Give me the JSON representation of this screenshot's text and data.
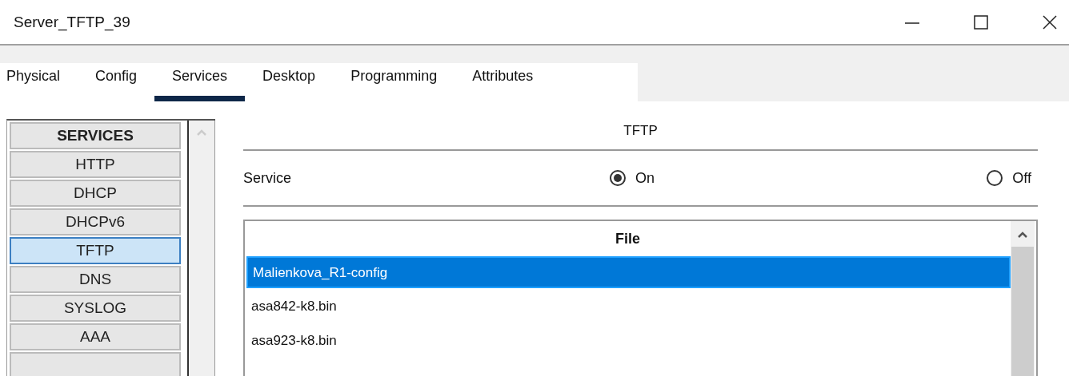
{
  "window": {
    "title": "Server_TFTP_39"
  },
  "tabs": [
    {
      "label": "Physical",
      "selected": false
    },
    {
      "label": "Config",
      "selected": false
    },
    {
      "label": "Services",
      "selected": true
    },
    {
      "label": "Desktop",
      "selected": false
    },
    {
      "label": "Programming",
      "selected": false
    },
    {
      "label": "Attributes",
      "selected": false
    }
  ],
  "sidebar": {
    "heading": "SERVICES",
    "items": [
      {
        "label": "HTTP",
        "selected": false
      },
      {
        "label": "DHCP",
        "selected": false
      },
      {
        "label": "DHCPv6",
        "selected": false
      },
      {
        "label": "TFTP",
        "selected": true
      },
      {
        "label": "DNS",
        "selected": false
      },
      {
        "label": "SYSLOG",
        "selected": false
      },
      {
        "label": "AAA",
        "selected": false
      },
      {
        "selected": false
      }
    ]
  },
  "panel": {
    "title": "TFTP",
    "service_label": "Service",
    "options": [
      {
        "label": "On",
        "selected": true
      },
      {
        "label": "Off",
        "selected": false
      }
    ]
  },
  "table": {
    "columns": [
      "File"
    ],
    "rows": [
      {
        "file": "Malienkova_R1-config",
        "selected": true
      },
      {
        "file": "asa842-k8.bin",
        "selected": false
      },
      {
        "file": "asa923-k8.bin",
        "selected": false
      }
    ]
  }
}
